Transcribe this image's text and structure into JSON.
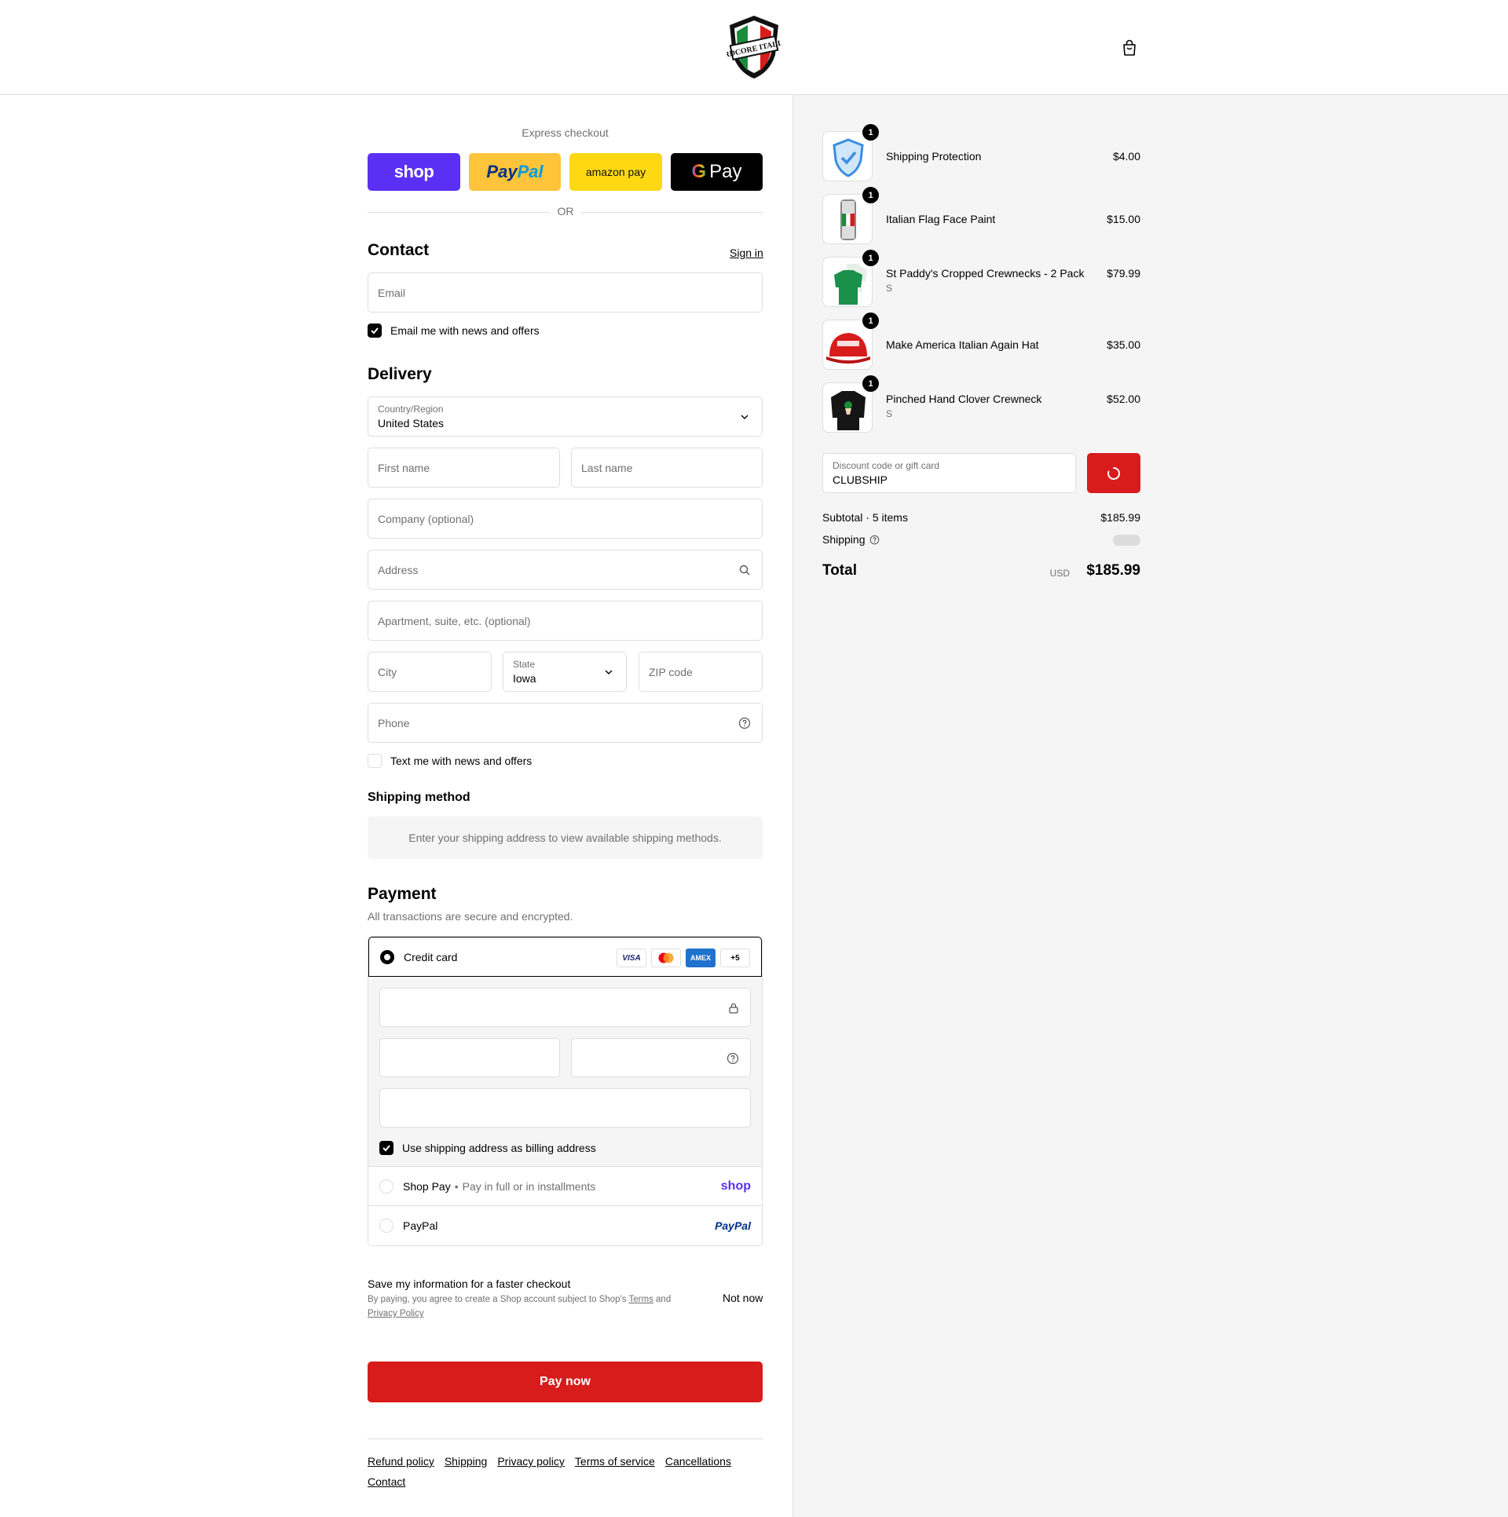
{
  "header": {
    "logo_text": "HARDCORE ITALIANS",
    "cart_icon": "shopping-bag-icon"
  },
  "express": {
    "title": "Express checkout",
    "shop_label": "shop",
    "paypal_label": "PayPal",
    "amazon_label": "amazon pay",
    "gpay_label": "G Pay",
    "or_label": "OR"
  },
  "contact": {
    "title": "Contact",
    "sign_in": "Sign in",
    "email_placeholder": "Email",
    "newsletter_label": "Email me with news and offers",
    "newsletter_checked": true
  },
  "delivery": {
    "title": "Delivery",
    "country_label": "Country/Region",
    "country_value": "United States",
    "first_name_placeholder": "First name",
    "last_name_placeholder": "Last name",
    "company_placeholder": "Company (optional)",
    "address_placeholder": "Address",
    "apartment_placeholder": "Apartment, suite, etc. (optional)",
    "city_placeholder": "City",
    "state_label": "State",
    "state_value": "Iowa",
    "zip_placeholder": "ZIP code",
    "phone_placeholder": "Phone",
    "sms_label": "Text me with news and offers",
    "sms_checked": false
  },
  "shipping_method": {
    "title": "Shipping method",
    "notice": "Enter your shipping address to view available shipping methods."
  },
  "payment": {
    "title": "Payment",
    "subtitle": "All transactions are secure and encrypted.",
    "credit_card_label": "Credit card",
    "card_brands": [
      "VISA",
      "Mastercard",
      "AMEX",
      "+5"
    ],
    "billing_same_label": "Use shipping address as billing address",
    "billing_same_checked": true,
    "shop_pay_label": "Shop Pay",
    "shop_pay_sep": "•",
    "shop_pay_desc": "Pay in full or in installments",
    "shop_pay_logo": "shop",
    "paypal_label": "PayPal",
    "paypal_logo": "PayPal"
  },
  "save_info": {
    "title": "Save my information for a faster checkout",
    "terms_prefix": "By paying, you agree to create a Shop account subject to Shop's ",
    "terms_link": "Terms",
    "terms_and": " and",
    "privacy_link": "Privacy Policy",
    "not_now": "Not now"
  },
  "pay_now": "Pay now",
  "footer": {
    "links": [
      "Refund policy",
      "Shipping",
      "Privacy policy",
      "Terms of service",
      "Cancellations",
      "Contact"
    ]
  },
  "summary": {
    "items": [
      {
        "name": "Shipping Protection",
        "variant": "",
        "price": "$4.00",
        "qty": "1"
      },
      {
        "name": "Italian Flag Face Paint",
        "variant": "",
        "price": "$15.00",
        "qty": "1"
      },
      {
        "name": "St Paddy's Cropped Crewnecks - 2 Pack",
        "variant": "S",
        "price": "$79.99",
        "qty": "1"
      },
      {
        "name": "Make America Italian Again Hat",
        "variant": "",
        "price": "$35.00",
        "qty": "1"
      },
      {
        "name": "Pinched Hand Clover Crewneck",
        "variant": "S",
        "price": "$52.00",
        "qty": "1"
      }
    ],
    "discount_label": "Discount code or gift card",
    "discount_value": "CLUBSHIP",
    "subtotal_label": "Subtotal · 5 items",
    "subtotal_value": "$185.99",
    "shipping_label": "Shipping",
    "total_label": "Total",
    "currency": "USD",
    "total_value": "$185.99"
  },
  "colors": {
    "accent_red": "#d81b1b",
    "shop_purple": "#5a31f4",
    "paypal_yellow": "#ffc439",
    "amazon_yellow": "#ffd814"
  }
}
